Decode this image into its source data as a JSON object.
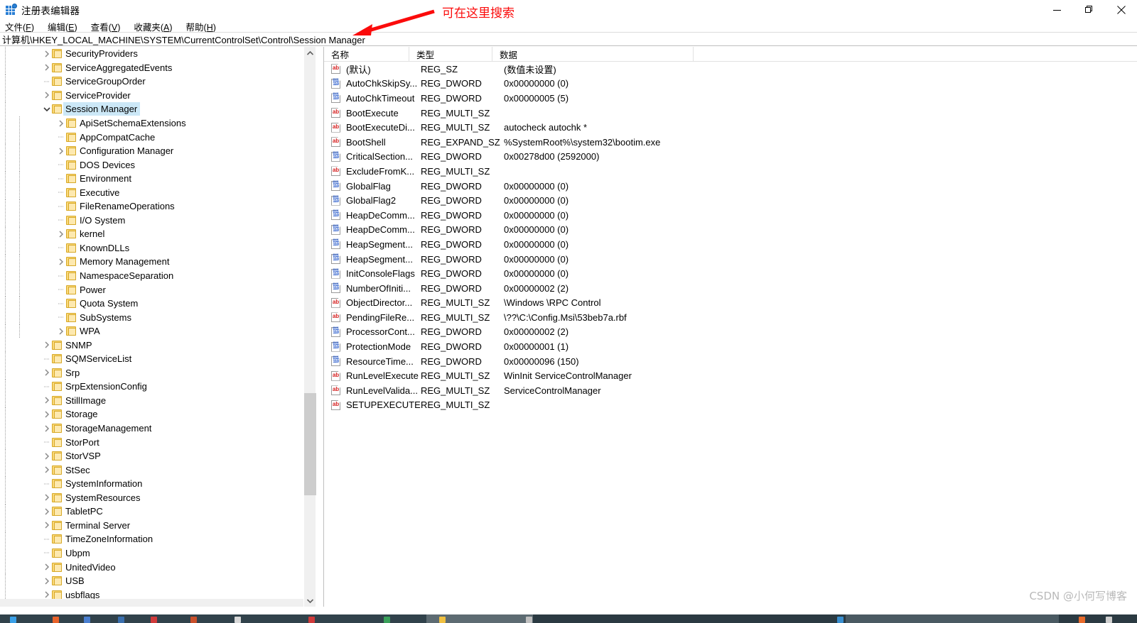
{
  "window": {
    "title": "注册表编辑器",
    "icon": "registry-editor-icon",
    "controls": {
      "minimize": "最小化",
      "maximize": "还原",
      "close": "关闭"
    }
  },
  "menubar": {
    "items": [
      {
        "label": "文件(F)",
        "text": "文件",
        "accel": "F"
      },
      {
        "label": "编辑(E)",
        "text": "编辑",
        "accel": "E"
      },
      {
        "label": "查看(V)",
        "text": "查看",
        "accel": "V"
      },
      {
        "label": "收藏夹(A)",
        "text": "收藏夹",
        "accel": "A"
      },
      {
        "label": "帮助(H)",
        "text": "帮助",
        "accel": "H"
      }
    ]
  },
  "address_bar": {
    "value": "计算机\\HKEY_LOCAL_MACHINE\\SYSTEM\\CurrentControlSet\\Control\\Session Manager",
    "placeholder": ""
  },
  "annotation": {
    "text": "可在这里搜索",
    "color": "#fb0b0b",
    "arrow": "red-arrow-pointing-to-address-bar"
  },
  "tree": {
    "selected": "Session Manager",
    "selection_color": "#cce8f7",
    "items": [
      {
        "label": "SecurityProviders",
        "depth": 1,
        "expander": "collapsed"
      },
      {
        "label": "ServiceAggregatedEvents",
        "depth": 1,
        "expander": "collapsed"
      },
      {
        "label": "ServiceGroupOrder",
        "depth": 1,
        "expander": "none"
      },
      {
        "label": "ServiceProvider",
        "depth": 1,
        "expander": "collapsed"
      },
      {
        "label": "Session Manager",
        "depth": 1,
        "expander": "expanded",
        "selected": true
      },
      {
        "label": "ApiSetSchemaExtensions",
        "depth": 2,
        "expander": "collapsed"
      },
      {
        "label": "AppCompatCache",
        "depth": 2,
        "expander": "none"
      },
      {
        "label": "Configuration Manager",
        "depth": 2,
        "expander": "collapsed"
      },
      {
        "label": "DOS Devices",
        "depth": 2,
        "expander": "none"
      },
      {
        "label": "Environment",
        "depth": 2,
        "expander": "none"
      },
      {
        "label": "Executive",
        "depth": 2,
        "expander": "none"
      },
      {
        "label": "FileRenameOperations",
        "depth": 2,
        "expander": "none"
      },
      {
        "label": "I/O System",
        "depth": 2,
        "expander": "none"
      },
      {
        "label": "kernel",
        "depth": 2,
        "expander": "collapsed"
      },
      {
        "label": "KnownDLLs",
        "depth": 2,
        "expander": "none"
      },
      {
        "label": "Memory Management",
        "depth": 2,
        "expander": "collapsed"
      },
      {
        "label": "NamespaceSeparation",
        "depth": 2,
        "expander": "none"
      },
      {
        "label": "Power",
        "depth": 2,
        "expander": "none"
      },
      {
        "label": "Quota System",
        "depth": 2,
        "expander": "none"
      },
      {
        "label": "SubSystems",
        "depth": 2,
        "expander": "none"
      },
      {
        "label": "WPA",
        "depth": 2,
        "expander": "collapsed"
      },
      {
        "label": "SNMP",
        "depth": 1,
        "expander": "collapsed"
      },
      {
        "label": "SQMServiceList",
        "depth": 1,
        "expander": "none"
      },
      {
        "label": "Srp",
        "depth": 1,
        "expander": "collapsed"
      },
      {
        "label": "SrpExtensionConfig",
        "depth": 1,
        "expander": "none"
      },
      {
        "label": "StillImage",
        "depth": 1,
        "expander": "collapsed"
      },
      {
        "label": "Storage",
        "depth": 1,
        "expander": "collapsed"
      },
      {
        "label": "StorageManagement",
        "depth": 1,
        "expander": "collapsed"
      },
      {
        "label": "StorPort",
        "depth": 1,
        "expander": "none"
      },
      {
        "label": "StorVSP",
        "depth": 1,
        "expander": "collapsed"
      },
      {
        "label": "StSec",
        "depth": 1,
        "expander": "collapsed"
      },
      {
        "label": "SystemInformation",
        "depth": 1,
        "expander": "none"
      },
      {
        "label": "SystemResources",
        "depth": 1,
        "expander": "collapsed"
      },
      {
        "label": "TabletPC",
        "depth": 1,
        "expander": "collapsed"
      },
      {
        "label": "Terminal Server",
        "depth": 1,
        "expander": "collapsed"
      },
      {
        "label": "TimeZoneInformation",
        "depth": 1,
        "expander": "none"
      },
      {
        "label": "Ubpm",
        "depth": 1,
        "expander": "none"
      },
      {
        "label": "UnitedVideo",
        "depth": 1,
        "expander": "collapsed"
      },
      {
        "label": "USB",
        "depth": 1,
        "expander": "collapsed"
      },
      {
        "label": "usbflags",
        "depth": 1,
        "expander": "collapsed"
      }
    ]
  },
  "value_list": {
    "columns": [
      "名称",
      "类型",
      "数据"
    ],
    "rows": [
      {
        "name": "(默认)",
        "type": "REG_SZ",
        "data": "(数值未设置)",
        "icon": "string-value-icon"
      },
      {
        "name": "AutoChkSkipSy...",
        "type": "REG_DWORD",
        "data": "0x00000000 (0)",
        "icon": "dword-value-icon"
      },
      {
        "name": "AutoChkTimeout",
        "type": "REG_DWORD",
        "data": "0x00000005 (5)",
        "icon": "dword-value-icon"
      },
      {
        "name": "BootExecute",
        "type": "REG_MULTI_SZ",
        "data": "",
        "icon": "string-value-icon"
      },
      {
        "name": "BootExecuteDi...",
        "type": "REG_MULTI_SZ",
        "data": "autocheck autochk *",
        "icon": "string-value-icon"
      },
      {
        "name": "BootShell",
        "type": "REG_EXPAND_SZ",
        "data": "%SystemRoot%\\system32\\bootim.exe",
        "icon": "string-value-icon"
      },
      {
        "name": "CriticalSection...",
        "type": "REG_DWORD",
        "data": "0x00278d00 (2592000)",
        "icon": "dword-value-icon"
      },
      {
        "name": "ExcludeFromK...",
        "type": "REG_MULTI_SZ",
        "data": "",
        "icon": "string-value-icon"
      },
      {
        "name": "GlobalFlag",
        "type": "REG_DWORD",
        "data": "0x00000000 (0)",
        "icon": "dword-value-icon"
      },
      {
        "name": "GlobalFlag2",
        "type": "REG_DWORD",
        "data": "0x00000000 (0)",
        "icon": "dword-value-icon"
      },
      {
        "name": "HeapDeComm...",
        "type": "REG_DWORD",
        "data": "0x00000000 (0)",
        "icon": "dword-value-icon"
      },
      {
        "name": "HeapDeComm...",
        "type": "REG_DWORD",
        "data": "0x00000000 (0)",
        "icon": "dword-value-icon"
      },
      {
        "name": "HeapSegment...",
        "type": "REG_DWORD",
        "data": "0x00000000 (0)",
        "icon": "dword-value-icon"
      },
      {
        "name": "HeapSegment...",
        "type": "REG_DWORD",
        "data": "0x00000000 (0)",
        "icon": "dword-value-icon"
      },
      {
        "name": "InitConsoleFlags",
        "type": "REG_DWORD",
        "data": "0x00000000 (0)",
        "icon": "dword-value-icon"
      },
      {
        "name": "NumberOfIniti...",
        "type": "REG_DWORD",
        "data": "0x00000002 (2)",
        "icon": "dword-value-icon"
      },
      {
        "name": "ObjectDirector...",
        "type": "REG_MULTI_SZ",
        "data": "\\Windows \\RPC Control",
        "icon": "string-value-icon"
      },
      {
        "name": "PendingFileRe...",
        "type": "REG_MULTI_SZ",
        "data": "\\??\\C:\\Config.Msi\\53beb7a.rbf",
        "icon": "string-value-icon"
      },
      {
        "name": "ProcessorCont...",
        "type": "REG_DWORD",
        "data": "0x00000002 (2)",
        "icon": "dword-value-icon"
      },
      {
        "name": "ProtectionMode",
        "type": "REG_DWORD",
        "data": "0x00000001 (1)",
        "icon": "dword-value-icon"
      },
      {
        "name": "ResourceTime...",
        "type": "REG_DWORD",
        "data": "0x00000096 (150)",
        "icon": "dword-value-icon"
      },
      {
        "name": "RunLevelExecute",
        "type": "REG_MULTI_SZ",
        "data": "WinInit ServiceControlManager",
        "icon": "string-value-icon"
      },
      {
        "name": "RunLevelValida...",
        "type": "REG_MULTI_SZ",
        "data": "ServiceControlManager",
        "icon": "string-value-icon"
      },
      {
        "name": "SETUPEXECUTE",
        "type": "REG_MULTI_SZ",
        "data": "",
        "icon": "string-value-icon"
      }
    ]
  },
  "watermark": {
    "text": "CSDN @小何写博客"
  }
}
